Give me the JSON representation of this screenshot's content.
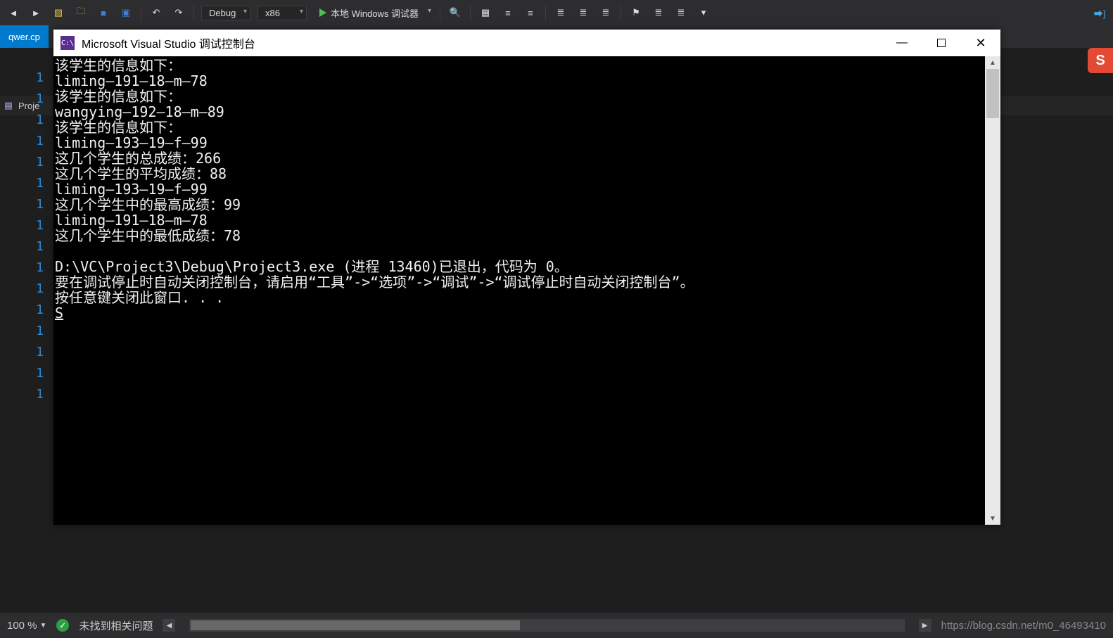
{
  "toolbar": {
    "config_dropdown": "Debug",
    "platform_dropdown": "x86",
    "run_label": "本地 Windows 调试器"
  },
  "tab": {
    "name": "qwer.cp"
  },
  "breadcrumb": {
    "text": "Proje"
  },
  "gutter_lines": [
    "1",
    "1",
    "1",
    "1",
    "1",
    "1",
    "1",
    "1",
    "1",
    "1",
    "1",
    "1",
    "1",
    "1",
    "1",
    "1"
  ],
  "console": {
    "title": "Microsoft Visual Studio 调试控制台",
    "lines": [
      "该学生的信息如下：",
      "liming—191—18—m—78",
      "该学生的信息如下：",
      "wangying—192—18—m—89",
      "该学生的信息如下：",
      "liming—193—19—f—99",
      "这几个学生的总成绩：266",
      "这几个学生的平均成绩：88",
      "liming—193—19—f—99",
      "这几个学生中的最高成绩：99",
      "liming—191—18—m—78",
      "这几个学生中的最低成绩：78",
      "",
      "D:\\VC\\Project3\\Debug\\Project3.exe (进程 13460)已退出，代码为 0。",
      "要在调试停止时自动关闭控制台，请启用“工具”->“选项”->“调试”->“调试停止时自动关闭控制台”。",
      "按任意键关闭此窗口. . ."
    ],
    "cursor_prefix": "S"
  },
  "status": {
    "zoom": "100 %",
    "issues_text": "未找到相关问题",
    "url": "https://blog.csdn.net/m0_46493410"
  },
  "right_badge": {
    "letter": "S"
  }
}
